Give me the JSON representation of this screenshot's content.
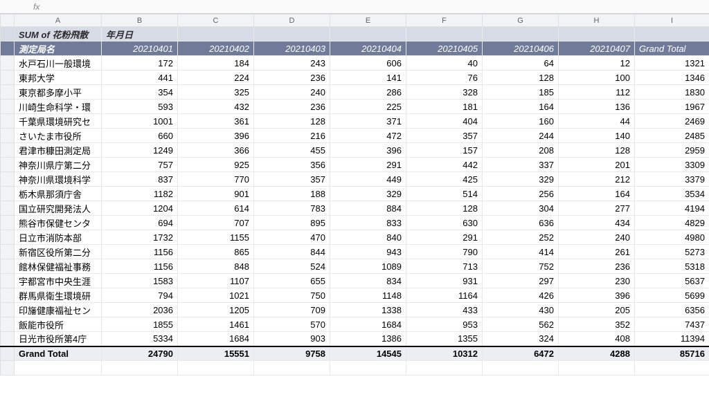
{
  "fx_label": "fx",
  "col_letters": [
    "A",
    "B",
    "C",
    "D",
    "E",
    "F",
    "G",
    "H",
    "I"
  ],
  "pivot": {
    "title_left": "SUM of 花粉飛散",
    "title_right": "年月日",
    "row_field": "測定局名",
    "col_headers": [
      "20210401",
      "20210402",
      "20210403",
      "20210404",
      "20210405",
      "20210406",
      "20210407",
      "Grand Total"
    ],
    "grand_label": "Grand Total"
  },
  "chart_data": {
    "type": "table",
    "title": "SUM of 花粉飛散 by 測定局名 × 年月日",
    "columns": [
      "20210401",
      "20210402",
      "20210403",
      "20210404",
      "20210405",
      "20210406",
      "20210407",
      "Grand Total"
    ],
    "rows": [
      {
        "name": "水戸石川一般環境",
        "values": [
          172,
          184,
          243,
          606,
          40,
          64,
          12,
          1321
        ]
      },
      {
        "name": "東邦大学",
        "values": [
          441,
          224,
          236,
          141,
          76,
          128,
          100,
          1346
        ]
      },
      {
        "name": "東京都多摩小平",
        "values": [
          354,
          325,
          240,
          286,
          328,
          185,
          112,
          1830
        ]
      },
      {
        "name": "川崎生命科学・環",
        "values": [
          593,
          432,
          236,
          225,
          181,
          164,
          136,
          1967
        ]
      },
      {
        "name": "千葉県環境研究セ",
        "values": [
          1001,
          361,
          128,
          371,
          404,
          160,
          44,
          2469
        ]
      },
      {
        "name": "さいたま市役所",
        "values": [
          660,
          396,
          216,
          472,
          357,
          244,
          140,
          2485
        ]
      },
      {
        "name": "君津市糠田測定局",
        "values": [
          1249,
          366,
          455,
          396,
          157,
          208,
          128,
          2959
        ]
      },
      {
        "name": "神奈川県庁第二分",
        "values": [
          757,
          925,
          356,
          291,
          442,
          337,
          201,
          3309
        ]
      },
      {
        "name": "神奈川県環境科学",
        "values": [
          837,
          770,
          357,
          449,
          425,
          329,
          212,
          3379
        ]
      },
      {
        "name": "栃木県那須庁舎",
        "values": [
          1182,
          901,
          188,
          329,
          514,
          256,
          164,
          3534
        ]
      },
      {
        "name": "国立研究開発法人",
        "values": [
          1204,
          614,
          783,
          884,
          128,
          304,
          277,
          4194
        ]
      },
      {
        "name": "熊谷市保健センタ",
        "values": [
          694,
          707,
          895,
          833,
          630,
          636,
          434,
          4829
        ]
      },
      {
        "name": "日立市消防本部",
        "values": [
          1732,
          1155,
          470,
          840,
          291,
          252,
          240,
          4980
        ]
      },
      {
        "name": "新宿区役所第二分",
        "values": [
          1156,
          865,
          844,
          943,
          790,
          414,
          261,
          5273
        ]
      },
      {
        "name": "館林保健福祉事務",
        "values": [
          1156,
          848,
          524,
          1089,
          713,
          752,
          236,
          5318
        ]
      },
      {
        "name": "宇都宮市中央生涯",
        "values": [
          1583,
          1107,
          655,
          834,
          931,
          297,
          230,
          5637
        ]
      },
      {
        "name": "群馬県衛生環境研",
        "values": [
          794,
          1021,
          750,
          1148,
          1164,
          426,
          396,
          5699
        ]
      },
      {
        "name": "印旛健康福祉セン",
        "values": [
          2036,
          1205,
          709,
          1338,
          433,
          430,
          205,
          6356
        ]
      },
      {
        "name": "飯能市役所",
        "values": [
          1855,
          1461,
          570,
          1684,
          953,
          562,
          352,
          7437
        ]
      },
      {
        "name": "日光市役所第4庁",
        "values": [
          5334,
          1684,
          903,
          1386,
          1355,
          324,
          408,
          11394
        ]
      }
    ],
    "grand_total": [
      24790,
      15551,
      9758,
      14545,
      10312,
      6472,
      4288,
      85716
    ]
  }
}
